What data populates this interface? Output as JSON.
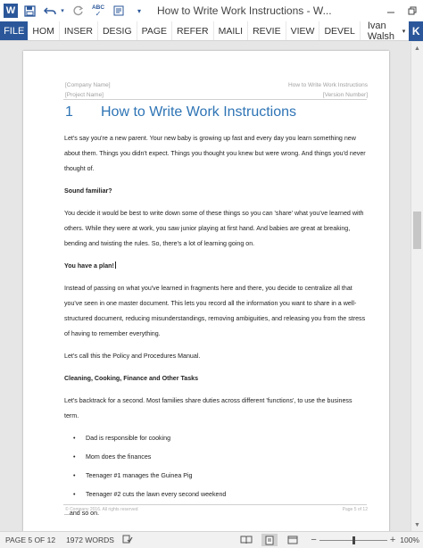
{
  "window": {
    "title": "How to Write Work Instructions - W...",
    "minimize_icon": "minimize-icon",
    "restore_icon": "restore-icon",
    "close_icon": "close-icon"
  },
  "quick_access": {
    "word_icon": "W",
    "save_icon": "save-icon",
    "undo_icon": "undo-icon",
    "redo_icon": "redo-icon",
    "spelling_icon": "ABC",
    "format_icon": "format-icon",
    "customize_icon": "chevron-down-icon"
  },
  "ribbon": {
    "file": "FILE",
    "tabs": [
      "HOM",
      "INSER",
      "DESIG",
      "PAGE",
      "REFER",
      "MAILI",
      "REVIE",
      "VIEW",
      "DEVEL"
    ],
    "user": "Ivan Walsh",
    "app_badge": "K"
  },
  "page": {
    "header": {
      "company": "[Company Name]",
      "project": "[Project Name]",
      "doc_title": "How to Write Work Instructions",
      "version": "[Version Number]"
    },
    "heading": {
      "number": "1",
      "text": "How to Write Work Instructions"
    },
    "body": {
      "p1": "Let's say you're a new parent. Your new baby is growing up fast and every day you learn something new about them. Things you didn't expect. Things you thought you knew but were wrong. And things you'd never thought of.",
      "h_sound": "Sound familiar?",
      "p2": "You decide it would be best to write down some of these things so you can 'share' what you've learned with others. While they were at work, you saw junior playing at first hand. And babies are great at breaking, bending and twisting the rules. So, there's a lot of learning going on.",
      "h_plan": "You have a plan!",
      "p3": "Instead of passing on what you've learned in fragments here and there, you decide to centralize all that you've seen in one master document. This lets you record all the information you want to share in a well-structured document, reducing misunderstandings, removing ambiguities, and releasing you from the stress of having to remember everything.",
      "p4": "Let's call this the Policy and Procedures Manual.",
      "h_clean": "Cleaning, Cooking, Finance and Other Tasks",
      "p5": "Let's backtrack for a second. Most families share duties across different 'functions', to use the business term.",
      "bullets": [
        "Dad is responsible for cooking",
        "Mom does the finances",
        "Teenager #1 manages the Guinea Pig",
        "Teenager #2 cuts the lawn every second weekend"
      ],
      "p6": "...and so on."
    },
    "footer": {
      "copyright": "© Company 2016. All rights reserved",
      "page_of": "Page 5 of 12"
    }
  },
  "status": {
    "page": "PAGE 5 OF 12",
    "words": "1972 WORDS",
    "zoom_minus": "−",
    "zoom_plus": "+",
    "zoom_pct": "100%",
    "zoom_level": 0.5
  }
}
